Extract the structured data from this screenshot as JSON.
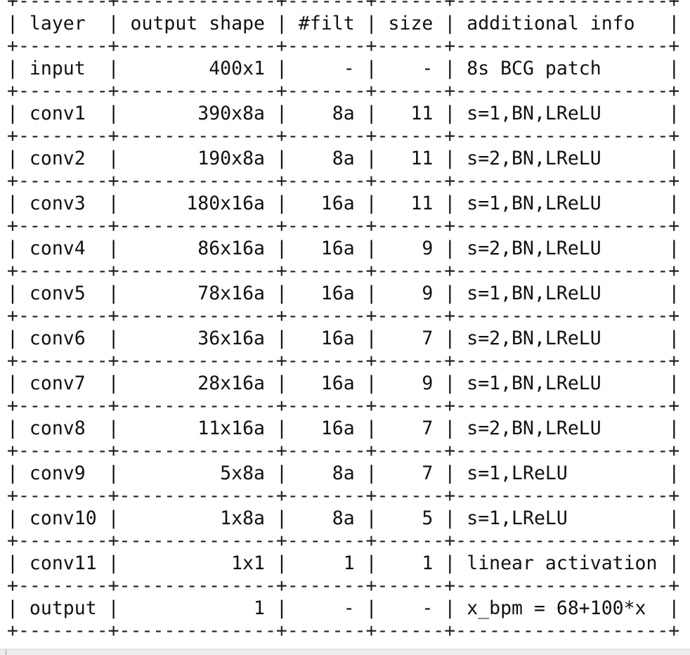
{
  "table": {
    "headers": [
      "layer",
      "output shape",
      "#filt",
      "size",
      "additional info"
    ],
    "rows": [
      [
        "input",
        "400x1",
        "-",
        "-",
        "8s BCG patch"
      ],
      [
        "conv1",
        "390x8a",
        "8a",
        "11",
        "s=1,BN,LReLU"
      ],
      [
        "conv2",
        "190x8a",
        "8a",
        "11",
        "s=2,BN,LReLU"
      ],
      [
        "conv3",
        "180x16a",
        "16a",
        "11",
        "s=1,BN,LReLU"
      ],
      [
        "conv4",
        "86x16a",
        "16a",
        "9",
        "s=2,BN,LReLU"
      ],
      [
        "conv5",
        "78x16a",
        "16a",
        "9",
        "s=1,BN,LReLU"
      ],
      [
        "conv6",
        "36x16a",
        "16a",
        "7",
        "s=2,BN,LReLU"
      ],
      [
        "conv7",
        "28x16a",
        "16a",
        "9",
        "s=1,BN,LReLU"
      ],
      [
        "conv8",
        "11x16a",
        "16a",
        "7",
        "s=2,BN,LReLU"
      ],
      [
        "conv9",
        "5x8a",
        "8a",
        "7",
        "s=1,LReLU"
      ],
      [
        "conv10",
        "1x8a",
        "8a",
        "5",
        "s=1,LReLU"
      ],
      [
        "conv11",
        "1x1",
        "1",
        "1",
        "linear activation"
      ],
      [
        "output",
        "1",
        "-",
        "-",
        "x_bpm = 68+100*x"
      ]
    ]
  }
}
